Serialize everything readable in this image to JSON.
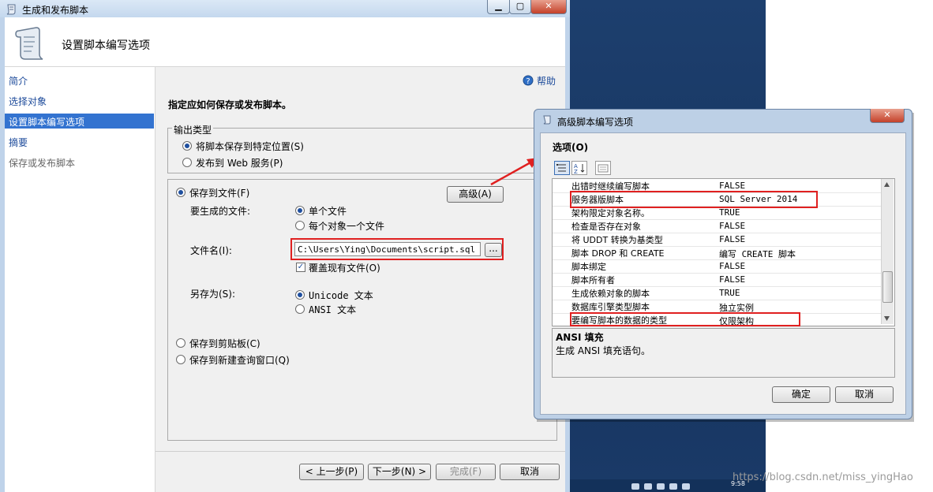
{
  "main_window": {
    "title": "生成和发布脚本",
    "header": "设置脚本编写选项",
    "min": "▁",
    "max": "▢",
    "close": "✕"
  },
  "nav": [
    "简介",
    "选择对象",
    "设置脚本编写选项",
    "摘要",
    "保存或发布脚本"
  ],
  "help": "帮助",
  "instruction": "指定应如何保存或发布脚本。",
  "output_type": {
    "label": "输出类型",
    "opt1": "将脚本保存到特定位置(S)",
    "opt2": "发布到 Web 服务(P)"
  },
  "save_file": {
    "label": "保存到文件(F)",
    "advanced": "高级(A)",
    "files_label": "要生成的文件:",
    "single": "单个文件",
    "per_object": "每个对象一个文件",
    "filename_label": "文件名(I):",
    "filename_value": "C:\\Users\\Ying\\Documents\\script.sql",
    "browse": "...",
    "overwrite": "覆盖现有文件(O)",
    "saveas_label": "另存为(S):",
    "unicode": "Unicode 文本",
    "ansi": "ANSI 文本"
  },
  "clipboard": "保存到剪贴板(C)",
  "new_query": "保存到新建查询窗口(Q)",
  "footer": {
    "prev": "< 上一步(P)",
    "next": "下一步(N) >",
    "finish": "完成(F)",
    "cancel": "取消"
  },
  "advanced_dialog": {
    "title": "高级脚本编写选项",
    "options_label": "选项(O)",
    "rows": [
      {
        "name": "出错时继续编写脚本",
        "value": "FALSE"
      },
      {
        "name": "服务器版脚本",
        "value": "SQL Server 2014"
      },
      {
        "name": "架构限定对象名称。",
        "value": "TRUE"
      },
      {
        "name": "检查是否存在对象",
        "value": "FALSE"
      },
      {
        "name": "将 UDDT 转换为基类型",
        "value": "FALSE"
      },
      {
        "name": "脚本 DROP 和 CREATE",
        "value": "编写 CREATE 脚本"
      },
      {
        "name": "脚本绑定",
        "value": "FALSE"
      },
      {
        "name": "脚本所有者",
        "value": "FALSE"
      },
      {
        "name": "生成依赖对象的脚本",
        "value": "TRUE"
      },
      {
        "name": "数据库引擎类型脚本",
        "value": "独立实例"
      },
      {
        "name": "要编写脚本的数据的类型",
        "value": "仅限架构"
      }
    ],
    "desc_title": "ANSI 填充",
    "desc_text": "生成 ANSI 填充语句。",
    "ok": "确定",
    "cancel": "取消",
    "close": "✕"
  },
  "taskbar_time": "9:58",
  "watermark": "https://blog.csdn.net/miss_yingHao",
  "colors": {
    "accent": "#3373d0",
    "highlight": "#e02020"
  }
}
